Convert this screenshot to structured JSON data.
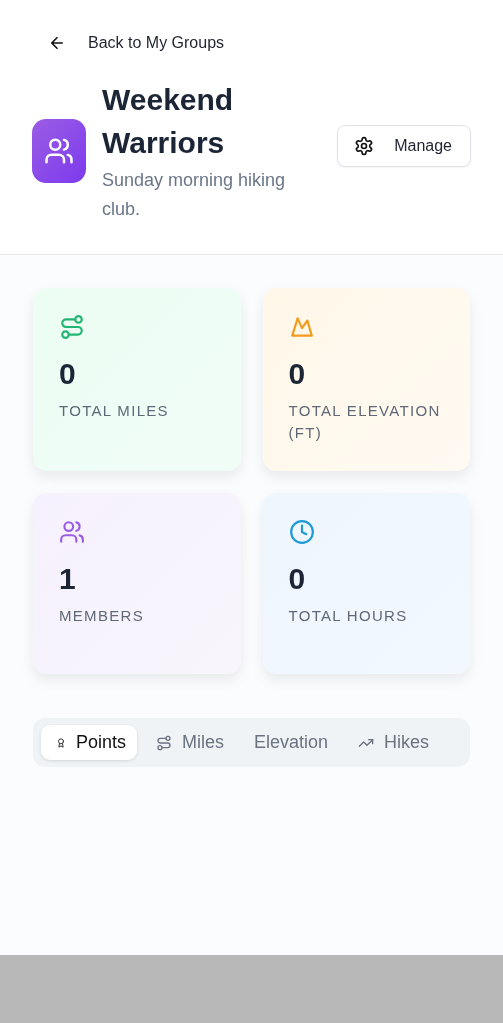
{
  "back_link": {
    "label": "Back to My Groups"
  },
  "group": {
    "name": "Weekend Warriors",
    "description": "Sunday morning hiking club.",
    "manage_button": "Manage"
  },
  "stats": [
    {
      "kind": "route",
      "value": "0",
      "label": "TOTAL MILES",
      "color": "#22b573"
    },
    {
      "kind": "mountain",
      "value": "0",
      "label": "TOTAL ELEVATION (FT)",
      "color": "#f29b1d"
    },
    {
      "kind": "users",
      "value": "1",
      "label": "MEMBERS",
      "color": "#9b5de5"
    },
    {
      "kind": "clock",
      "value": "0",
      "label": "TOTAL HOURS",
      "color": "#1e9ad6"
    }
  ],
  "tabs": [
    {
      "kind": "award",
      "label": "Points",
      "selected": true
    },
    {
      "kind": "route",
      "label": "Miles",
      "selected": false
    },
    {
      "kind": "none",
      "label": "Elevation",
      "selected": false
    },
    {
      "kind": "trend",
      "label": "Hikes",
      "selected": false
    }
  ]
}
